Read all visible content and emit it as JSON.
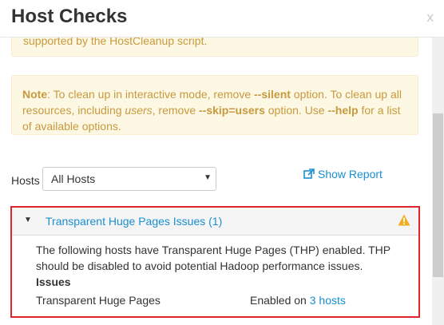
{
  "header": {
    "title": "Host Checks",
    "close": "x"
  },
  "alerts": {
    "top_partial": "supported by the HostCleanup script.",
    "note": {
      "label": "Note",
      "t1": ": To clean up in interactive mode, remove ",
      "opt_silent": "--silent",
      "t2": " option. To clean up all resources, including ",
      "users": "users",
      "t3": ", remove ",
      "opt_skip": "--skip=users",
      "t4": " option. Use ",
      "opt_help": "--help",
      "t5": " for a list of available options."
    }
  },
  "hosts": {
    "label": "Hosts",
    "selected": "All Hosts",
    "show_report": "Show Report"
  },
  "panel": {
    "title": "Transparent Huge Pages Issues (1)",
    "description": "The following hosts have Transparent Huge Pages (THP) enabled. THP should be disabled to avoid potential Hadoop performance issues.",
    "issues_heading": "Issues",
    "issue_name": "Transparent Huge Pages",
    "status_prefix": "Enabled on ",
    "status_link": "3 hosts"
  },
  "colors": {
    "link": "#1a8fd1",
    "warning_text": "#c9993f",
    "warning_bg": "#fcf8e3",
    "highlight_border": "#e0242c",
    "warn_icon": "#f0ad1e"
  }
}
